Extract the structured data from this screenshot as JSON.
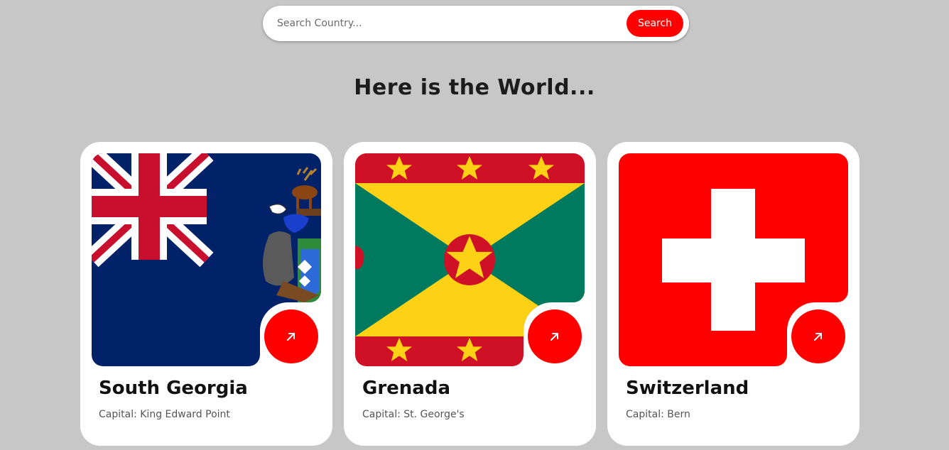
{
  "search": {
    "placeholder": "Search Country...",
    "button_label": "Search"
  },
  "heading": "Here is the World...",
  "cards": [
    {
      "name": "South Georgia",
      "capital": "Capital: King Edward Point"
    },
    {
      "name": "Grenada",
      "capital": "Capital: St. George's"
    },
    {
      "name": "Switzerland",
      "capital": "Capital: Bern"
    }
  ],
  "colors": {
    "accent": "#ff0000",
    "background": "#c7c7c7",
    "card": "#ffffff"
  },
  "icons": {
    "card_button": "arrow-up-right-icon"
  }
}
